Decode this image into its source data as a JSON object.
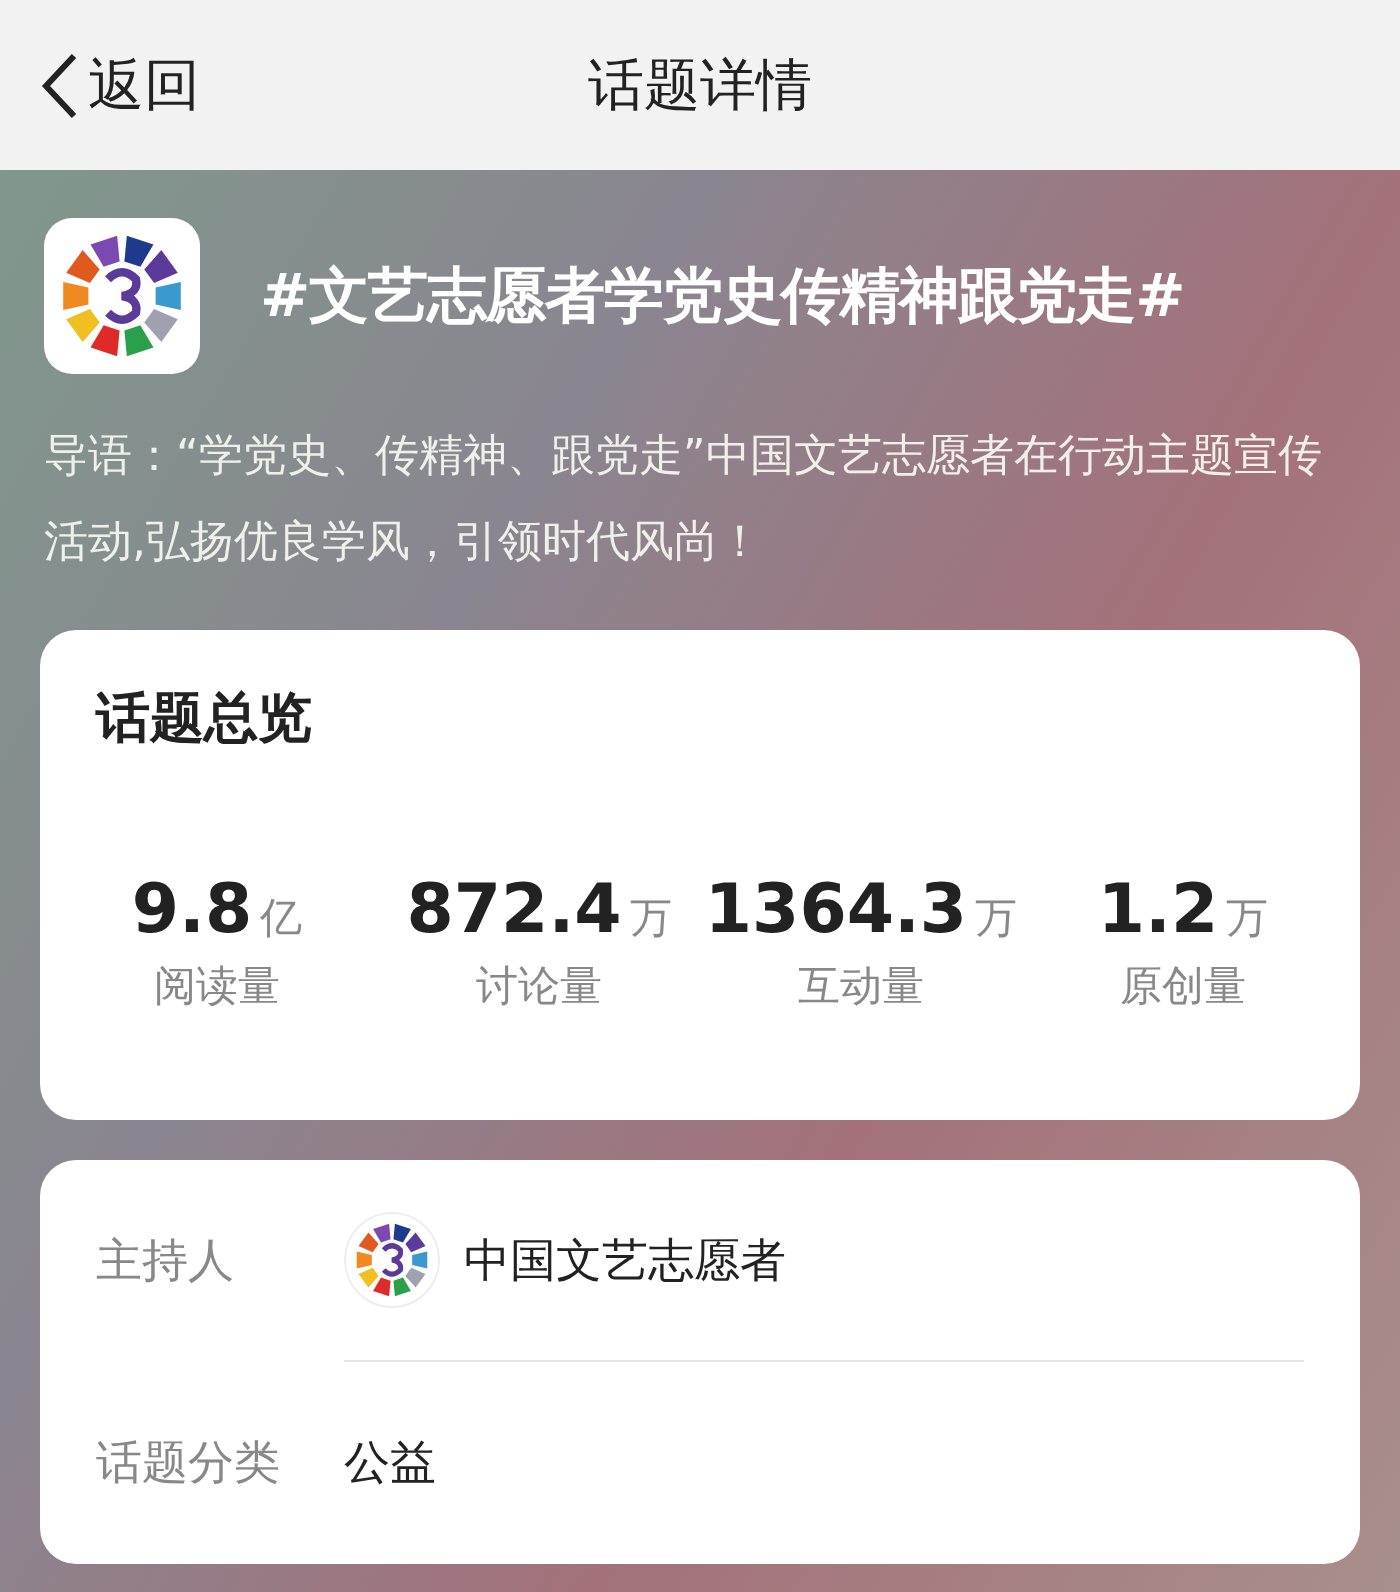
{
  "nav": {
    "back": "返回",
    "title": "话题详情"
  },
  "topic": {
    "title": "#文艺志愿者学党史传精神跟党走#",
    "intro": "导语：“学党史、传精神、跟党走”中国文艺志愿者在行动主题宣传活动,弘扬优良学风，引领时代风尚！"
  },
  "overview": {
    "heading": "话题总览",
    "stats": [
      {
        "value": "9.8",
        "unit": "亿",
        "label": "阅读量"
      },
      {
        "value": "872.4",
        "unit": "万",
        "label": "讨论量"
      },
      {
        "value": "1364.3",
        "unit": "万",
        "label": "互动量"
      },
      {
        "value": "1.2",
        "unit": "万",
        "label": "原创量"
      }
    ]
  },
  "info": [
    {
      "kind": "host",
      "label": "主持人",
      "value": "中国文艺志愿者"
    },
    {
      "kind": "text",
      "label": "话题分类",
      "value": "公益"
    }
  ]
}
